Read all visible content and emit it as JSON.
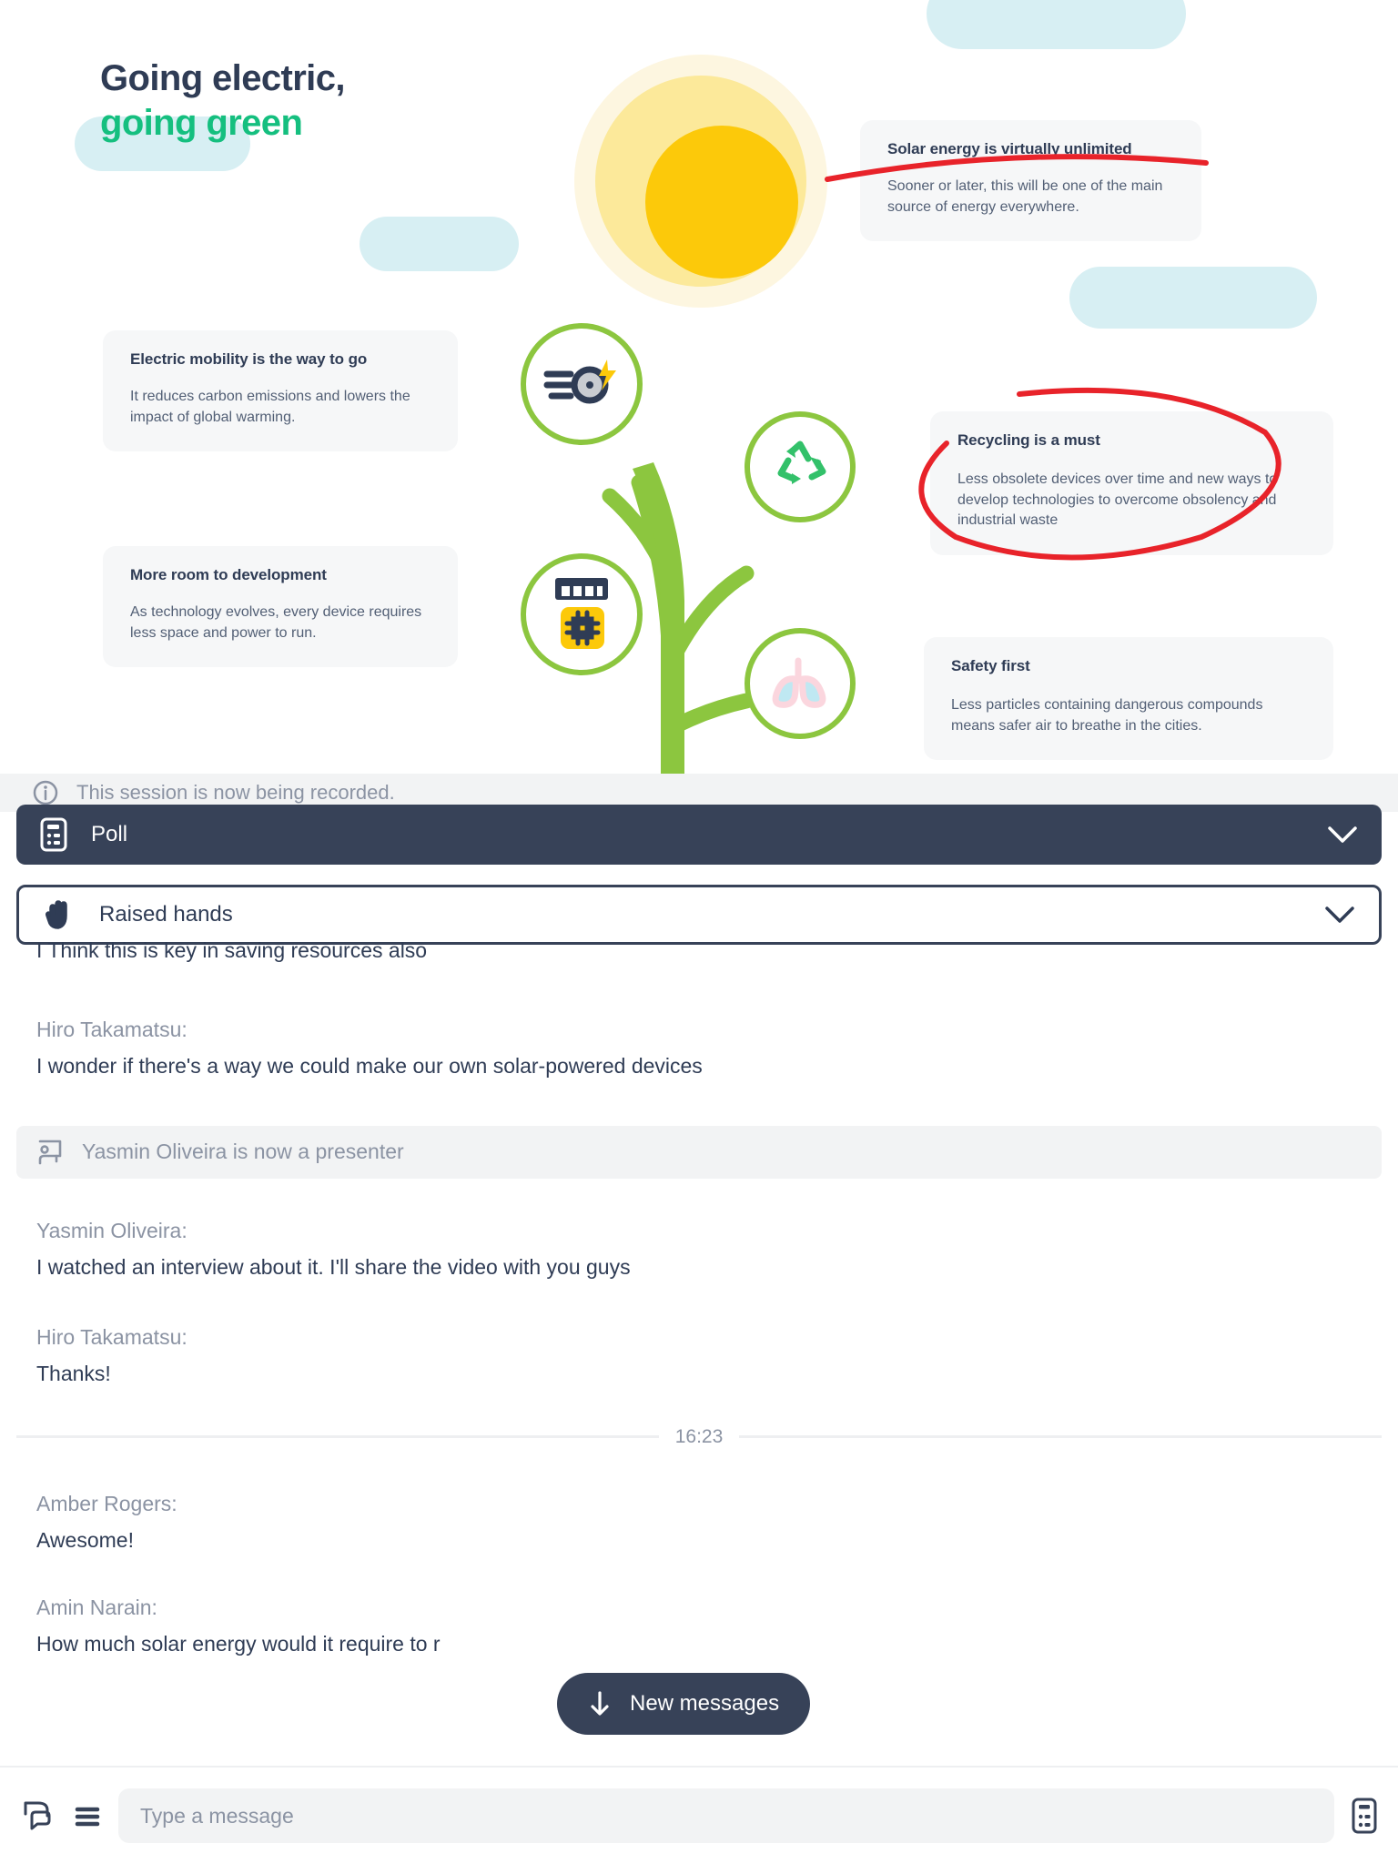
{
  "slide": {
    "title_line1": "Going electric,",
    "title_line2": "going green",
    "accent_green": "#15bf7f",
    "accent_navy": "#2f3c55",
    "leaf_green": "#8cc63f",
    "sun_yellow": "#fcc90a",
    "annotation_red": "#e8232a",
    "cards": [
      {
        "id": "solar",
        "heading": "Solar energy is virtually unlimited",
        "body": "Sooner or later, this will be one of the main source of energy everywhere."
      },
      {
        "id": "mobility",
        "heading": "Electric mobility is the way to go",
        "body": "It reduces carbon emissions and lowers the impact of global warming."
      },
      {
        "id": "room",
        "heading": "More room to development",
        "body": "As technology evolves, every device requires less space and power to run."
      },
      {
        "id": "recycling",
        "heading": "Recycling is a must",
        "body": "Less obsolete devices over time and new ways to develop technologies to overcome obsolency and industrial waste"
      },
      {
        "id": "safety",
        "heading": "Safety first",
        "body": "Less particles containing dangerous compounds means safer air to breathe in the cities."
      }
    ],
    "node_icons": [
      "electric-wheel-icon",
      "recycle-icon",
      "microchip-icon",
      "lungs-icon"
    ]
  },
  "recording_banner": {
    "icon": "info-icon",
    "text": "This session is now being recorded."
  },
  "panels": [
    {
      "id": "poll",
      "label": "Poll",
      "icon": "poll-icon",
      "chevron": "chevron-down-icon"
    },
    {
      "id": "raised-hands",
      "label": "Raised hands",
      "icon": "raised-hand-icon",
      "chevron": "chevron-down-icon"
    }
  ],
  "chat": {
    "items": [
      {
        "type": "message-continued",
        "text": "I Think this is key in saving resources also"
      },
      {
        "type": "message",
        "author": "Hiro Takamatsu:",
        "text": "I wonder if there's a way we could make our own solar-powered devices"
      },
      {
        "type": "system",
        "icon": "presenter-icon",
        "text": "Yasmin Oliveira is now a presenter"
      },
      {
        "type": "message",
        "author": "Yasmin Oliveira:",
        "text": "I watched an interview about it. I'll share the video with you guys"
      },
      {
        "type": "message",
        "author": "Hiro Takamatsu:",
        "text": "Thanks!"
      },
      {
        "type": "divider",
        "time": "16:23"
      },
      {
        "type": "message",
        "author": "Amber Rogers:",
        "text": "Awesome!"
      },
      {
        "type": "message",
        "author": "Amin Narain:",
        "text": "How much solar energy would it require to r"
      }
    ]
  },
  "new_messages": {
    "label": "New messages",
    "icon": "arrow-down-icon"
  },
  "composer": {
    "placeholder": "Type a message",
    "value": "",
    "left_icons": [
      "chat-reply-icon",
      "menu-icon"
    ],
    "right_icons": [
      "poll-icon"
    ]
  }
}
